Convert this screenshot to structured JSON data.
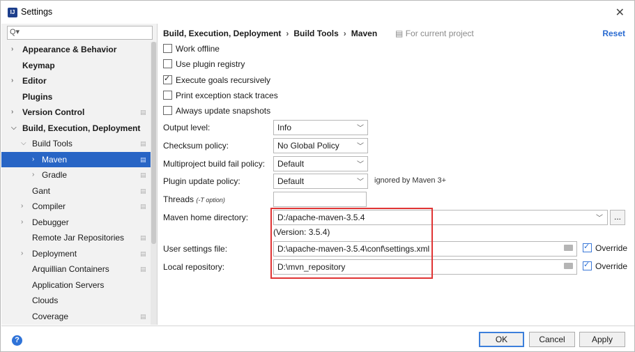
{
  "window": {
    "title": "Settings",
    "icon": "intellij-icon",
    "close": "✕"
  },
  "sidebar": {
    "search_placeholder": "",
    "items": [
      {
        "label": "Appearance & Behavior",
        "bold": true,
        "arrow": "right"
      },
      {
        "label": "Keymap",
        "bold": true
      },
      {
        "label": "Editor",
        "bold": true,
        "arrow": "right"
      },
      {
        "label": "Plugins",
        "bold": true
      },
      {
        "label": "Version Control",
        "bold": true,
        "arrow": "right",
        "copy": true
      },
      {
        "label": "Build, Execution, Deployment",
        "bold": true,
        "arrow": "down"
      },
      {
        "label": "Build Tools",
        "arrow": "down",
        "copy": true
      },
      {
        "label": "Maven",
        "arrow": "right",
        "copy": true,
        "selected": true
      },
      {
        "label": "Gradle",
        "arrow": "right",
        "copy": true
      },
      {
        "label": "Gant",
        "copy": true
      },
      {
        "label": "Compiler",
        "arrow": "right",
        "copy": true
      },
      {
        "label": "Debugger",
        "arrow": "right"
      },
      {
        "label": "Remote Jar Repositories",
        "copy": true
      },
      {
        "label": "Deployment",
        "arrow": "right",
        "copy": true
      },
      {
        "label": "Arquillian Containers",
        "copy": true
      },
      {
        "label": "Application Servers"
      },
      {
        "label": "Clouds"
      },
      {
        "label": "Coverage",
        "copy": true
      }
    ]
  },
  "breadcrumb": [
    "Build, Execution, Deployment",
    "Build Tools",
    "Maven"
  ],
  "scope_hint": "For current project",
  "reset_label": "Reset",
  "checkboxes": [
    {
      "label": "Work offline",
      "checked": false
    },
    {
      "label": "Use plugin registry",
      "checked": false
    },
    {
      "label": "Execute goals recursively",
      "checked": true
    },
    {
      "label": "Print exception stack traces",
      "checked": false
    },
    {
      "label": "Always update snapshots",
      "checked": false
    }
  ],
  "fields": {
    "output_level": {
      "label": "Output level:",
      "value": "Info"
    },
    "checksum_policy": {
      "label": "Checksum policy:",
      "value": "No Global Policy"
    },
    "multiproject_fail_policy": {
      "label": "Multiproject build fail policy:",
      "value": "Default"
    },
    "plugin_update_policy": {
      "label": "Plugin update policy:",
      "value": "Default",
      "note": "ignored by Maven 3+"
    },
    "threads": {
      "label": "Threads",
      "hint": "(-T option)",
      "value": ""
    },
    "maven_home": {
      "label": "Maven home directory:",
      "value": "D:/apache-maven-3.5.4",
      "version": "(Version: 3.5.4)"
    },
    "user_settings": {
      "label": "User settings file:",
      "value": "D:\\apache-maven-3.5.4\\conf\\settings.xml",
      "override": "Override"
    },
    "local_repo": {
      "label": "Local repository:",
      "value": "D:\\mvn_repository",
      "override": "Override"
    }
  },
  "ellipsis_label": "...",
  "buttons": {
    "ok": "OK",
    "cancel": "Cancel",
    "apply": "Apply"
  },
  "colors": {
    "selection": "#2865c5",
    "link": "#2a6bd1",
    "highlight_box": "#e03434"
  }
}
